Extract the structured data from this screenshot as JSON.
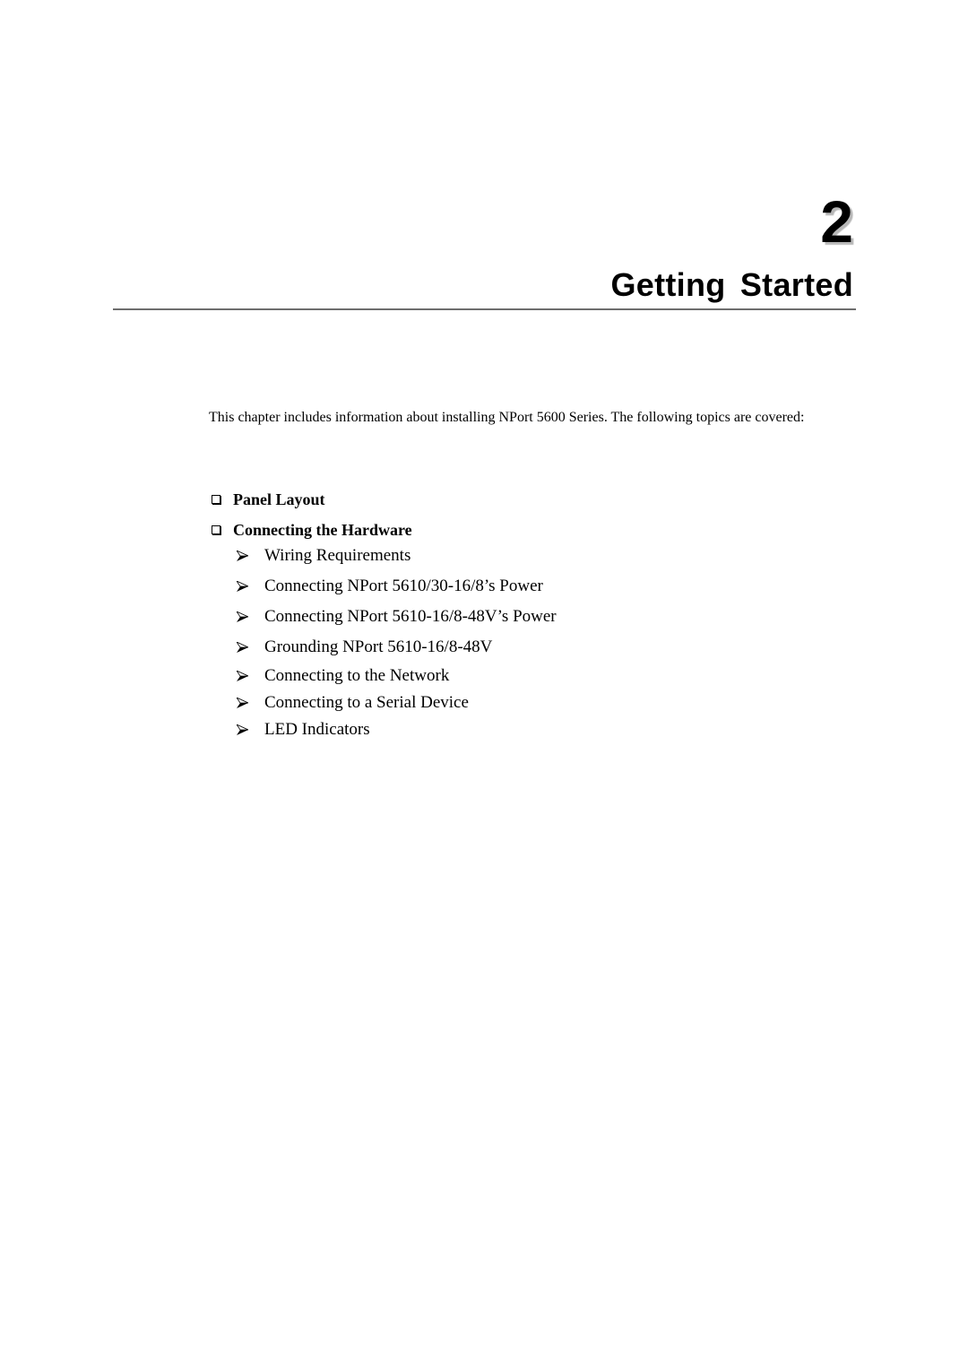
{
  "chapter": {
    "number": "2",
    "title": "Getting Started"
  },
  "intro": "This chapter includes information about installing NPort 5600 Series. The following topics are covered:",
  "topics": [
    {
      "label": "Panel Layout",
      "icon": "checkbox-square-icon"
    },
    {
      "label": "Connecting the Hardware",
      "icon": "checkbox-square-icon"
    }
  ],
  "subtopics": [
    {
      "label": "Wiring Requirements",
      "icon": "arrow-bullet-icon"
    },
    {
      "label": "Connecting NPort 5610/30-16/8’s Power",
      "icon": "arrow-bullet-icon"
    },
    {
      "label": "Connecting NPort 5610-16/8-48V’s Power",
      "icon": "arrow-bullet-icon"
    },
    {
      "label": "Grounding NPort 5610-16/8-48V",
      "icon": "arrow-bullet-icon"
    },
    {
      "label": "Connecting to the Network",
      "icon": "arrow-bullet-icon"
    },
    {
      "label": "Connecting to a Serial Device",
      "icon": "arrow-bullet-icon"
    },
    {
      "label": "LED Indicators",
      "icon": "arrow-bullet-icon"
    }
  ]
}
